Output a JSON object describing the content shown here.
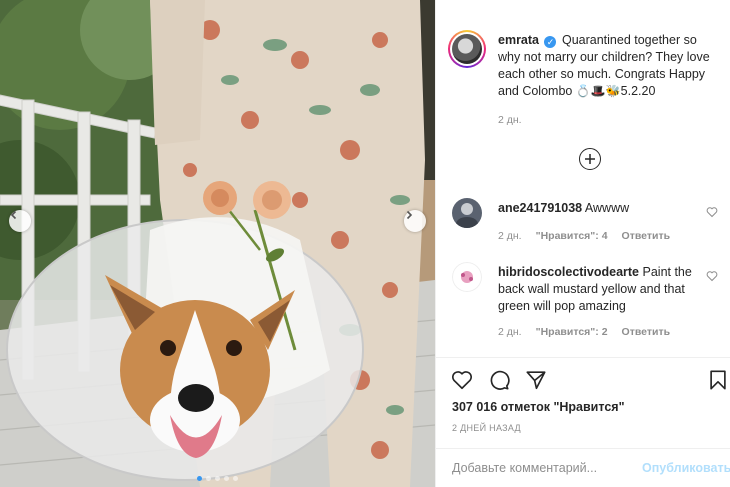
{
  "post": {
    "username": "emrata",
    "caption": "Quarantined together so why not marry our children? They love each other so much. Congrats Happy and Colombo",
    "caption_emoji": "💍🎩🐝",
    "caption_date": "5.2.20",
    "verified_mark": "✓",
    "time": "2 дн.",
    "likes": "307 016 отметок \"Нравится\"",
    "posted_ago": "2 ДНЕЙ НАЗАД"
  },
  "comments": [
    {
      "username": "ane241791038",
      "text": "Awwww",
      "time": "2 дн.",
      "likes": "\"Нравится\": 4",
      "reply": "Ответить"
    },
    {
      "username": "hibridoscolectivodearte",
      "text": "Paint the back wall mustard yellow and that green will pop amazing",
      "time": "2 дн.",
      "likes": "\"Нравится\": 2",
      "reply": "Ответить"
    }
  ],
  "comment_box": {
    "placeholder": "Добавьте комментарий...",
    "publish_label": "Опубликовать"
  },
  "icons": {
    "like": "heart-icon",
    "comment": "comment-bubble-icon",
    "share": "paper-plane-icon",
    "save": "bookmark-icon",
    "more": "plus-circle-icon",
    "prev": "chevron-left-icon",
    "next": "chevron-right-icon"
  },
  "colors": {
    "accent": "#3897f0",
    "publish_disabled": "#b2dffc",
    "muted": "#8e8e8e",
    "text": "#262626"
  },
  "carousel": {
    "slides": 5,
    "active": 1
  }
}
